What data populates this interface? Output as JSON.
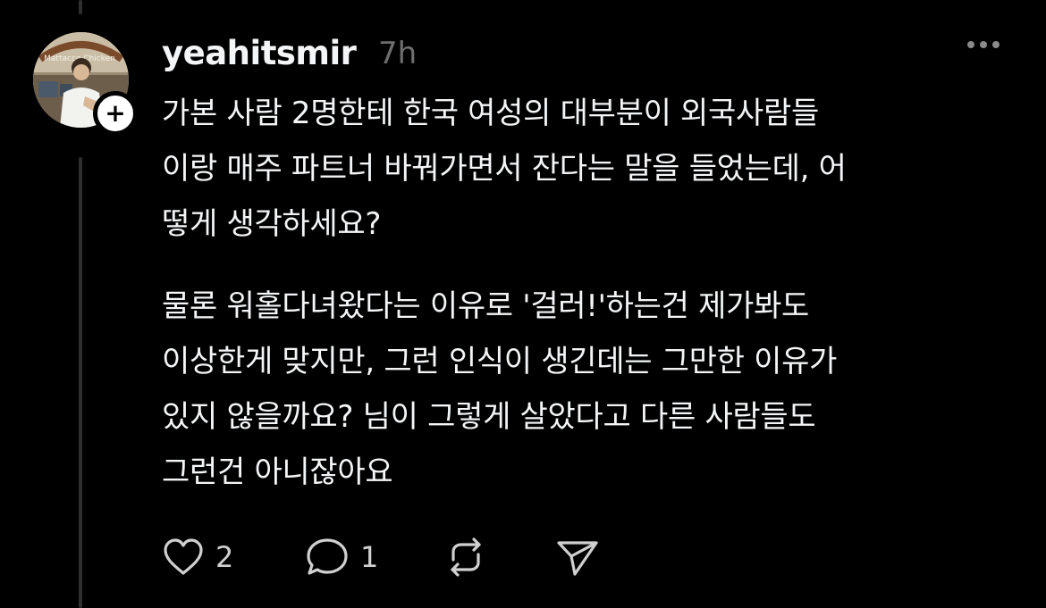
{
  "post": {
    "username": "yeahitsmir",
    "time": "7h",
    "avatar_caption": "Mattacco Chicken",
    "paragraphs": [
      "가본 사람 2명한테 한국 여성의 대부분이 외국사람들\n이랑 매주 파트너 바꿔가면서 잔다는 말을 들었는데, 어\n떻게 생각하세요?",
      "물론 워홀다녀왔다는 이유로 '걸러!'하는건 제가봐도\n이상한게 맞지만, 그런 인식이 생긴데는 그만한 이유가\n있지 않을까요? 님이 그렇게 살았다고 다른 사람들도\n그런건 아니잖아요"
    ]
  },
  "actions": {
    "like_count": "2",
    "reply_count": "1",
    "like_icon": "heart-icon",
    "reply_icon": "speech-bubble-icon",
    "repost_icon": "repost-icon",
    "share_icon": "send-icon"
  },
  "colors": {
    "background": "#000000",
    "text": "#f3f5f7",
    "muted": "#6e6e6e",
    "thread_line": "#2f2f2f"
  }
}
